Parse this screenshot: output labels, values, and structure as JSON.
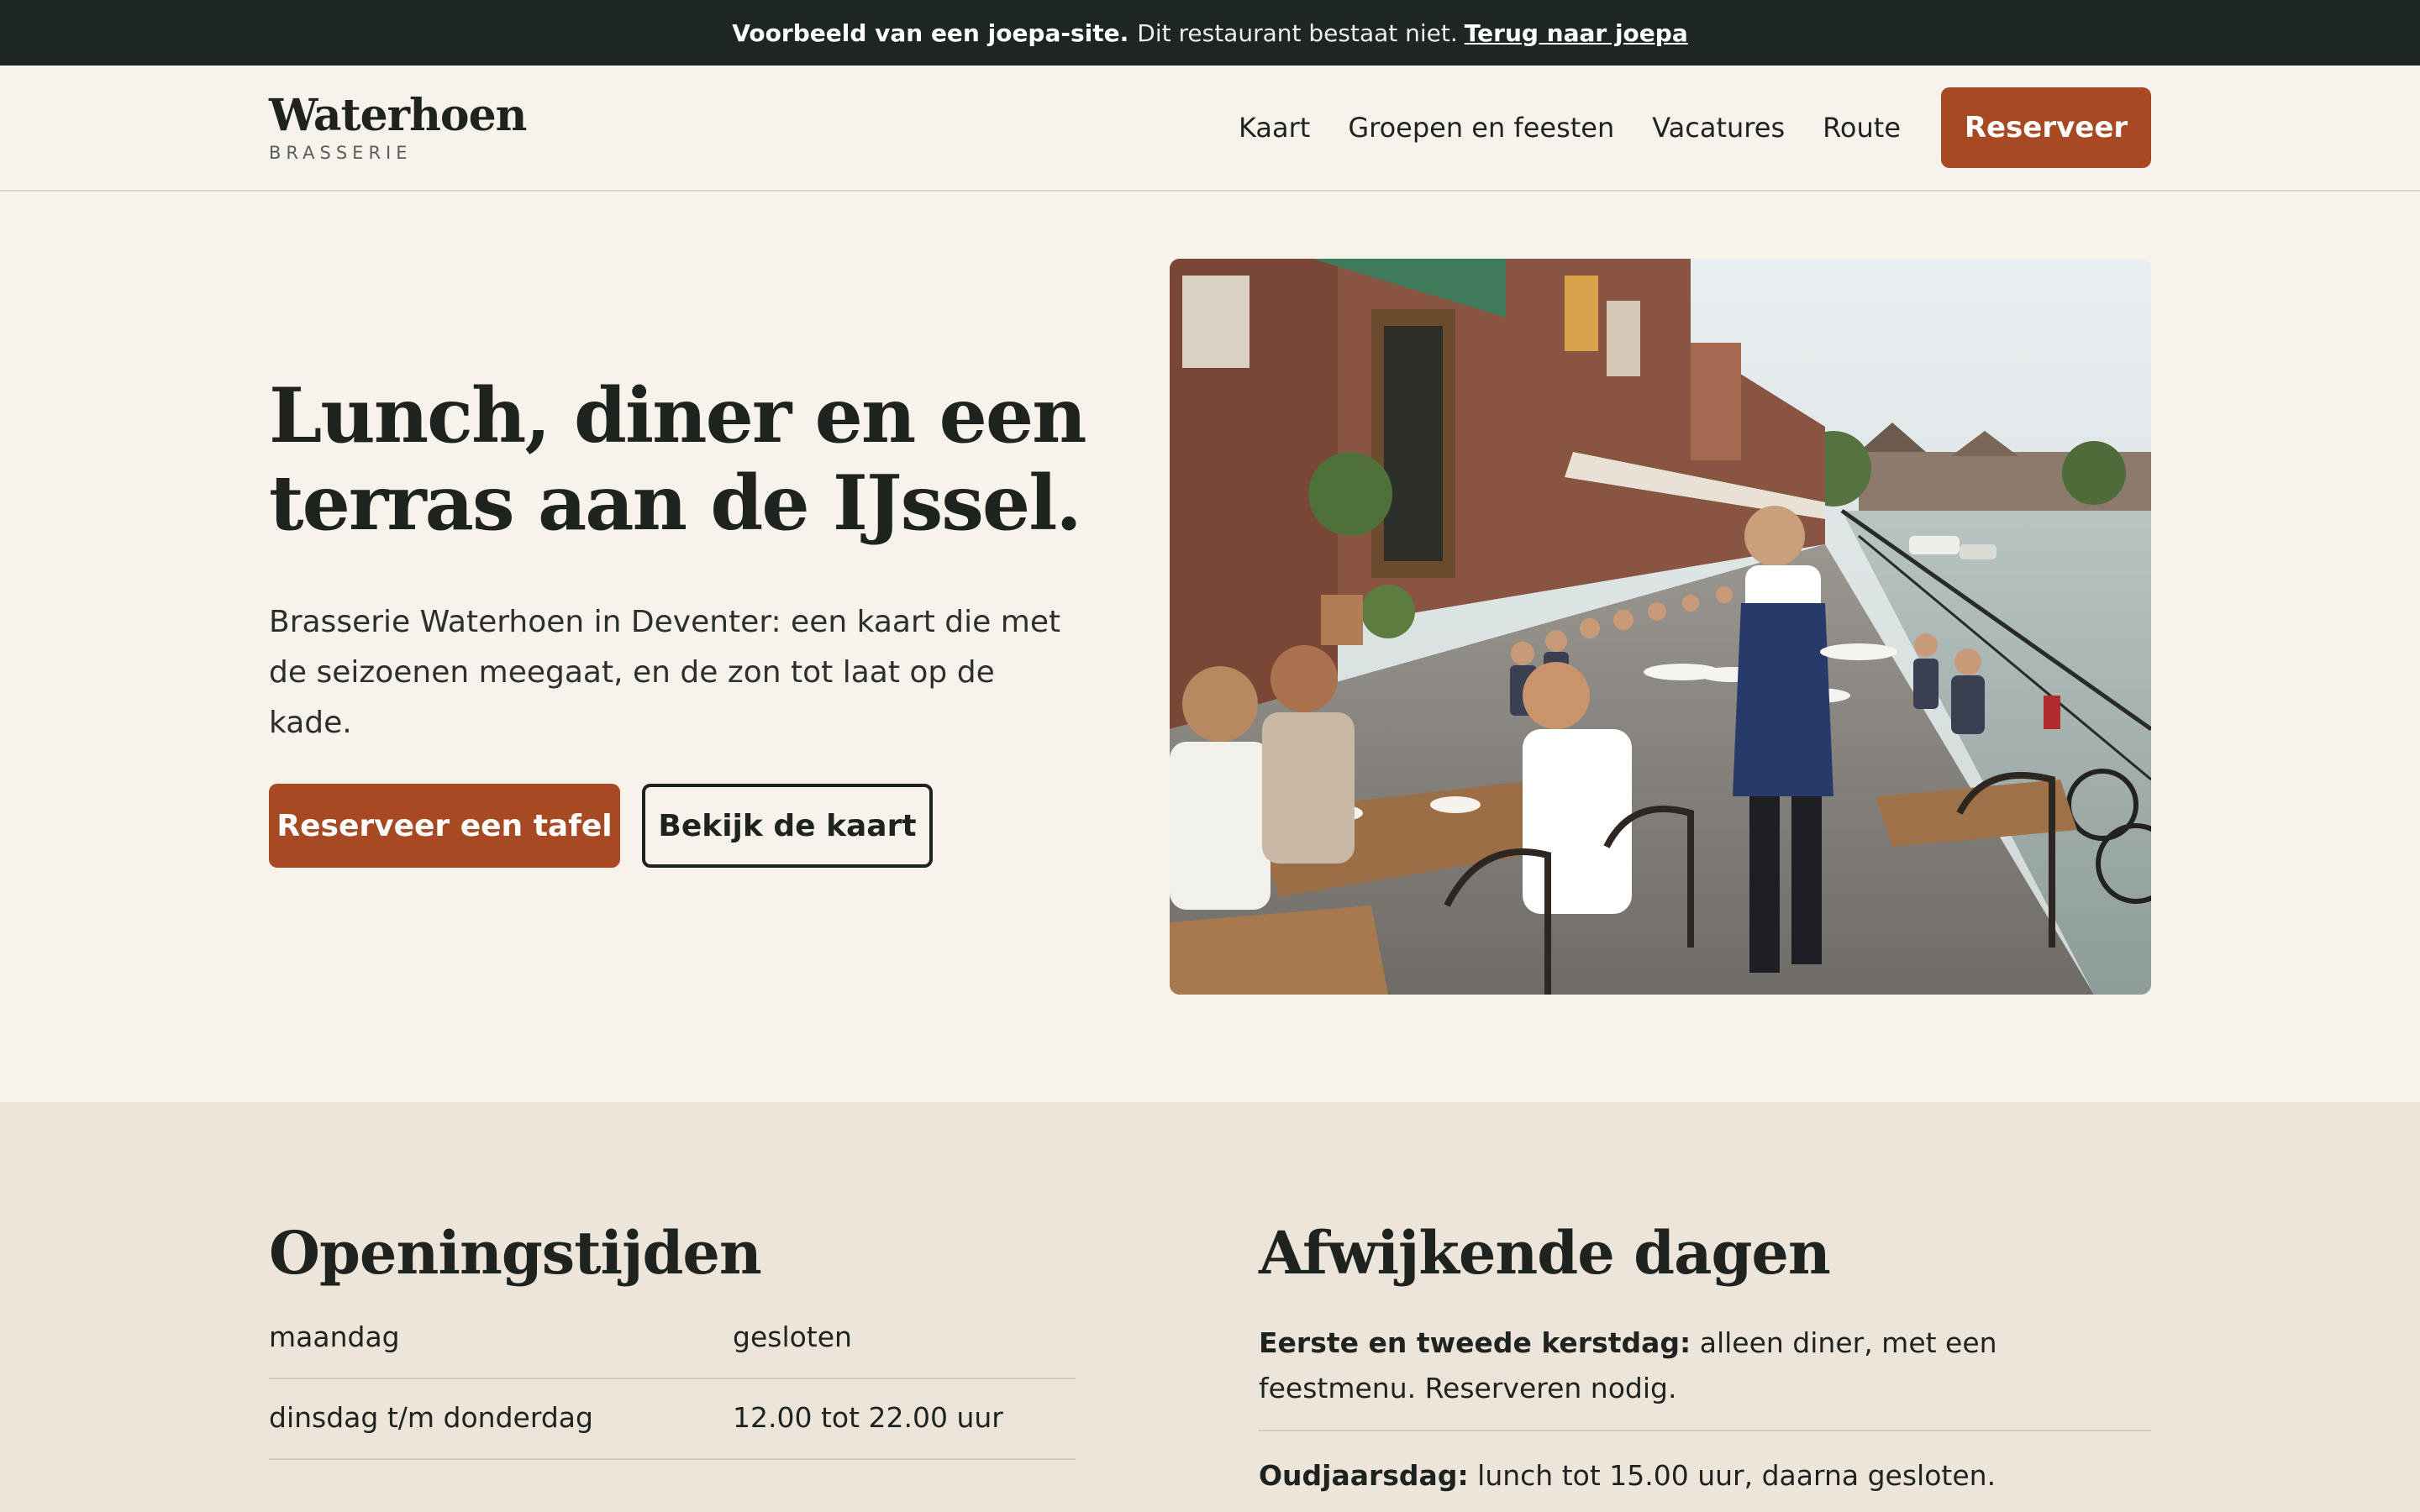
{
  "banner": {
    "bold_text": "Voorbeeld van een joepa-site.",
    "message": "Dit restaurant bestaat niet.",
    "link": "Terug naar joepa"
  },
  "header": {
    "logo_name": "Waterhoen",
    "logo_sub": "BRASSERIE",
    "nav": [
      "Kaart",
      "Groepen en feesten",
      "Vacatures",
      "Route"
    ],
    "cta": "Reserveer"
  },
  "hero": {
    "title_line1": "Lunch, diner en een",
    "title_line2": "terras aan de IJssel.",
    "text": "Brasserie Waterhoen in Deventer: een kaart die met de seizoenen meegaat, en de zon tot laat op de kade.",
    "primary_button": "Reserveer een tafel",
    "secondary_button": "Bekijk de kaart"
  },
  "hours": {
    "title": "Openingstijden",
    "rows": [
      {
        "day": "maandag",
        "time": "gesloten"
      },
      {
        "day": "dinsdag t/m donderdag",
        "time": "12.00 tot 22.00 uur"
      }
    ]
  },
  "special": {
    "title": "Afwijkende dagen",
    "items": [
      {
        "label": "Eerste en tweede kerstdag:",
        "text": "alleen diner, met een feestmenu. Reserveren nodig."
      },
      {
        "label": "Oudjaarsdag:",
        "text": "lunch tot 15.00 uur, daarna gesloten."
      }
    ]
  },
  "colors": {
    "accent": "#a74a24",
    "banner_bg": "#1d2623",
    "page_bg": "#f7f3ea",
    "section_bg": "#ede5d9"
  }
}
